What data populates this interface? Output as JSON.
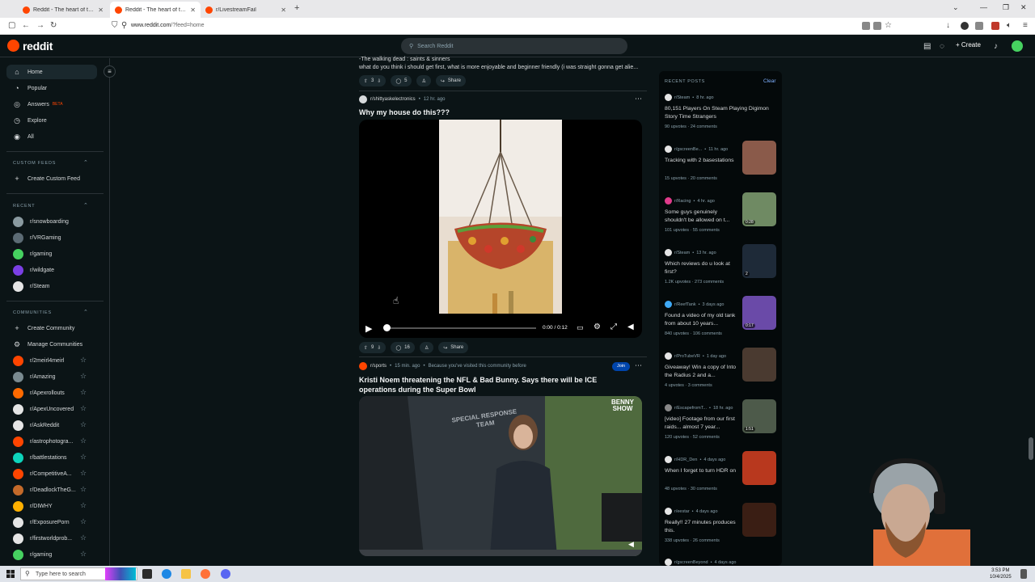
{
  "browser": {
    "tabs": [
      {
        "title": "Reddit - The heart of the internet"
      },
      {
        "title": "Reddit - The heart of the internet"
      },
      {
        "title": "r/LivestreamFail"
      }
    ],
    "url_domain": "www.reddit.com",
    "url_path": "/?feed=home"
  },
  "header": {
    "logo": "reddit",
    "search_placeholder": "Search Reddit",
    "create_label": "Create"
  },
  "sidebar": {
    "nav": [
      {
        "label": "Home",
        "icon": "home-icon"
      },
      {
        "label": "Popular",
        "icon": "popular-icon"
      },
      {
        "label": "Answers",
        "icon": "answers-icon",
        "badge": "BETA"
      },
      {
        "label": "Explore",
        "icon": "explore-icon"
      },
      {
        "label": "All",
        "icon": "all-icon"
      }
    ],
    "custom_feeds_heading": "CUSTOM FEEDS",
    "create_custom_feed": "Create Custom Feed",
    "recent_heading": "RECENT",
    "recent": [
      {
        "label": "r/snowboarding",
        "color": "#8a9aa0"
      },
      {
        "label": "r/VRGaming",
        "color": "#5c6b74"
      },
      {
        "label": "r/gaming",
        "color": "#46d160"
      },
      {
        "label": "r/wildgate",
        "color": "#7b3fe4"
      },
      {
        "label": "r/Steam",
        "color": "#e5e5e5"
      }
    ],
    "communities_heading": "COMMUNITIES",
    "create_community": "Create Community",
    "manage_communities": "Manage Communities",
    "communities": [
      {
        "label": "r/2meirl4meirl",
        "color": "#ff4500"
      },
      {
        "label": "r/Amazing",
        "color": "#7a8a90"
      },
      {
        "label": "r/Apexrollouts",
        "color": "#ff6a00"
      },
      {
        "label": "r/ApexUncovered",
        "color": "#e5e5e5"
      },
      {
        "label": "r/AskReddit",
        "color": "#e5e5e5"
      },
      {
        "label": "r/astrophotogra...",
        "color": "#ff4500"
      },
      {
        "label": "r/battlestations",
        "color": "#0dd3bb"
      },
      {
        "label": "r/CompetitiveA...",
        "color": "#ff4500"
      },
      {
        "label": "r/DeadlockTheG...",
        "color": "#c46a2a"
      },
      {
        "label": "r/DIWHY",
        "color": "#ffb000"
      },
      {
        "label": "r/ExposurePorn",
        "color": "#e5e5e5"
      },
      {
        "label": "r/firstworldprob...",
        "color": "#e5e5e5"
      },
      {
        "label": "r/gaming",
        "color": "#46d160"
      }
    ]
  },
  "feed": {
    "prev_post": {
      "line1": "-The walking dead : saints & sinners",
      "line2": "what do you think i should get first, what is more enjoyable and beginner friendly (i was straight gonna get alie...",
      "votes": "3",
      "comments": "5",
      "share": "Share"
    },
    "post1": {
      "subreddit": "r/shittyaskelectronics",
      "time": "12 hr. ago",
      "title": "Why my house do this???",
      "video_time": "0:00 / 0:12",
      "votes": "9",
      "comments": "16",
      "share": "Share"
    },
    "post2": {
      "subreddit": "r/sports",
      "time": "15 min. ago",
      "reason": "Because you've visited this community before",
      "join": "Join",
      "title": "Kristi Noem threatening the NFL & Bad Bunny. Says there will be ICE operations during the Super Bowl",
      "overlay_line1": "BENNY",
      "overlay_line2": "SHOW",
      "sign_line1": "SPECIAL RESPONSE",
      "sign_line2": "TEAM"
    }
  },
  "recent_posts": {
    "heading": "RECENT POSTS",
    "clear": "Clear",
    "items": [
      {
        "sub": "r/Steam",
        "time": "8 hr. ago",
        "title": "80,151 Players On Steam Playing Digimon Story Time Strangers",
        "upvotes": "90 upvotes",
        "comments": "24 comments",
        "dot": "#e5e5e5",
        "thumb": null
      },
      {
        "sub": "r/gscreenBe...",
        "time": "11 hr. ago",
        "title": "Tracking with 2 basestations",
        "upvotes": "15 upvotes",
        "comments": "20 comments",
        "dot": "#e5e5e5",
        "thumb": "#8a5a4a"
      },
      {
        "sub": "r/Racing",
        "time": "4 hr. ago",
        "title": "Some guys genuinely shouldn't be allowed on t...",
        "upvotes": "101 upvotes",
        "comments": "55 comments",
        "dot": "#e03b8b",
        "thumb": "#6f8a63",
        "badge": "0:28"
      },
      {
        "sub": "r/Steam",
        "time": "13 hr. ago",
        "title": "Which reviews do u look at first?",
        "upvotes": "1.2K upvotes",
        "comments": "273 comments",
        "dot": "#e5e5e5",
        "thumb": "#1e2a38",
        "badge": "2"
      },
      {
        "sub": "r/ReefTank",
        "time": "3 days ago",
        "title": "Found a video of my old tank from about 10 years...",
        "upvotes": "840 upvotes",
        "comments": "106 comments",
        "dot": "#3fa9f5",
        "thumb": "#6a4aa8",
        "badge": "0:17"
      },
      {
        "sub": "r/ProTubeVR",
        "time": "1 day ago",
        "title": "Giveaway! Win a copy of Into the Radius 2 and a...",
        "upvotes": "4 upvotes",
        "comments": "3 comments",
        "dot": "#e5e5e5",
        "thumb": "#4a3a30"
      },
      {
        "sub": "r/EscapefromT...",
        "time": "18 hr. ago",
        "title": "[video] Footage from our first raids... almost 7 year...",
        "upvotes": "120 upvotes",
        "comments": "52 comments",
        "dot": "#888888",
        "thumb": "#4d5a4a",
        "badge": "1:51"
      },
      {
        "sub": "r/HDR_Den",
        "time": "4 days ago",
        "title": "When I forget to turn HDR on",
        "upvotes": "48 upvotes",
        "comments": "30 comments",
        "dot": "#e5e5e5",
        "thumb": "#b8381e"
      },
      {
        "sub": "r/eestar",
        "time": "4 days ago",
        "title": "Really!! 27 minutes produces this.",
        "upvotes": "338 upvotes",
        "comments": "26 comments",
        "dot": "#e5e5e5",
        "thumb": "#3a1e14"
      },
      {
        "sub": "r/gscreenBeyond",
        "time": "4 days ago",
        "title": "",
        "upvotes": "",
        "comments": "",
        "dot": "#e5e5e5",
        "thumb": null
      }
    ]
  },
  "taskbar": {
    "search_placeholder": "Type here to search",
    "time": "3:53 PM",
    "date": "10/4/2025"
  }
}
